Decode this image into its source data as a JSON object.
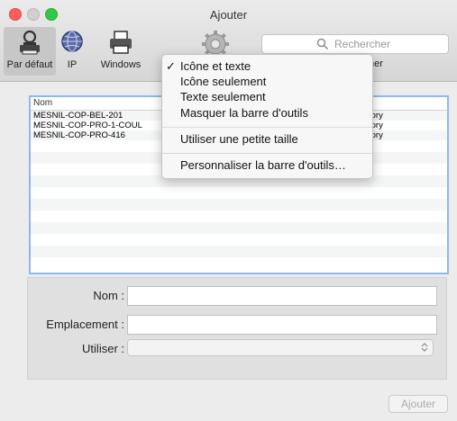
{
  "window": {
    "title": "Ajouter",
    "close_color": "#fc605c",
    "max_color": "#34c84a"
  },
  "toolbar": {
    "items": [
      {
        "label": "Par défaut",
        "icon": "default-printer-icon",
        "selected": true
      },
      {
        "label": "IP",
        "icon": "globe-icon",
        "selected": false
      },
      {
        "label": "Windows",
        "icon": "printer-icon",
        "selected": false
      }
    ],
    "advanced_icon": "gear-icon",
    "search_placeholder": "Rechercher",
    "search_label_suffix": "her"
  },
  "context_menu": {
    "items": [
      {
        "label": "Icône et texte",
        "checked": true,
        "check_mark": "✓"
      },
      {
        "label": "Icône seulement",
        "checked": false
      },
      {
        "label": "Texte seulement",
        "checked": false
      },
      {
        "label": "Masquer la barre d'outils",
        "checked": false
      },
      {
        "label": "Utiliser une petite taille",
        "checked": false
      },
      {
        "label": "Personnaliser la barre d'outils…",
        "checked": false
      }
    ]
  },
  "printer_list": {
    "column_header": "Nom",
    "rows": [
      {
        "name": "MESNIL-COP-BEL-201",
        "suffix": "tory"
      },
      {
        "name": "MESNIL-COP-PRO-1-COUL",
        "suffix": "tory"
      },
      {
        "name": "MESNIL-COP-PRO-416",
        "suffix": "tory"
      }
    ],
    "selection_color": "#8fb7f0"
  },
  "form": {
    "name_label": "Nom :",
    "name_value": "",
    "location_label": "Emplacement :",
    "location_value": "",
    "use_label": "Utiliser :",
    "use_value": ""
  },
  "actions": {
    "add_label": "Ajouter"
  }
}
